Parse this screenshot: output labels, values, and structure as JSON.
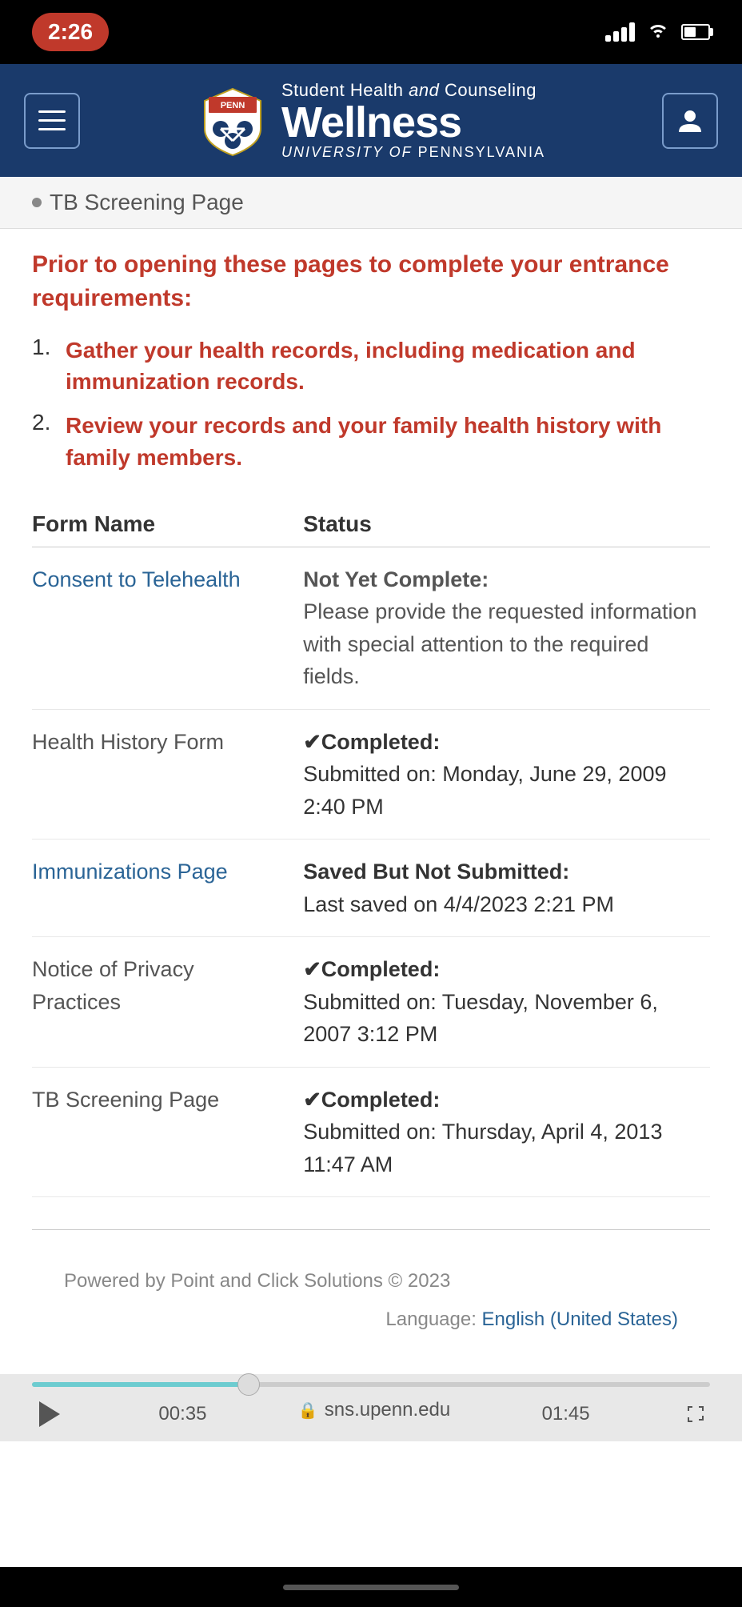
{
  "statusBar": {
    "time": "2:26",
    "signalBars": 3,
    "hasBattery": true
  },
  "header": {
    "logoTopLine": "Student Health and Counseling",
    "logoMainName": "Wellness",
    "logoSubLine": "UNIVERSITY of PENNSYLVANIA",
    "menuLabel": "Menu",
    "profileLabel": "Profile"
  },
  "breadcrumb": {
    "text": "TB Screening Page"
  },
  "instructions": {
    "header": "Prior to opening these pages to complete your entrance requirements:",
    "items": [
      {
        "number": "1.",
        "text": "Gather your health records, including medication and immunization records."
      },
      {
        "number": "2.",
        "text": "Review your records and your family health history with family members."
      }
    ]
  },
  "formsTable": {
    "col1Header": "Form Name",
    "col2Header": "Status",
    "rows": [
      {
        "formName": "Consent to Telehealth",
        "isLink": true,
        "statusType": "not-complete",
        "statusLabel": "Not Yet Complete:",
        "statusDetail": "Please provide the requested information with special attention to the required fields."
      },
      {
        "formName": "Health History Form",
        "isLink": false,
        "statusType": "completed",
        "statusLabel": "✔Completed:",
        "statusDetail": "Submitted on: Monday, June 29, 2009 2:40 PM"
      },
      {
        "formName": "Immunizations Page",
        "isLink": true,
        "statusType": "saved",
        "statusLabel": "Saved But Not Submitted:",
        "statusDetail": "Last saved on 4/4/2023 2:21 PM"
      },
      {
        "formName": "Notice of Privacy Practices",
        "isLink": false,
        "statusType": "completed",
        "statusLabel": "✔Completed:",
        "statusDetail": "Submitted on: Tuesday, November 6, 2007 3:12 PM"
      },
      {
        "formName": "TB Screening Page",
        "isLink": false,
        "statusType": "completed",
        "statusLabel": "✔Completed:",
        "statusDetail": "Submitted on: Thursday, April 4, 2013 11:47 AM"
      }
    ]
  },
  "footer": {
    "poweredBy": "Powered by Point and Click Solutions © 2023",
    "languageLabel": "Language:",
    "languageValue": "English (United States)"
  },
  "videoBar": {
    "currentTime": "00:35",
    "totalTime": "01:45",
    "url": "sns.upenn.edu",
    "progressPercent": 32
  }
}
